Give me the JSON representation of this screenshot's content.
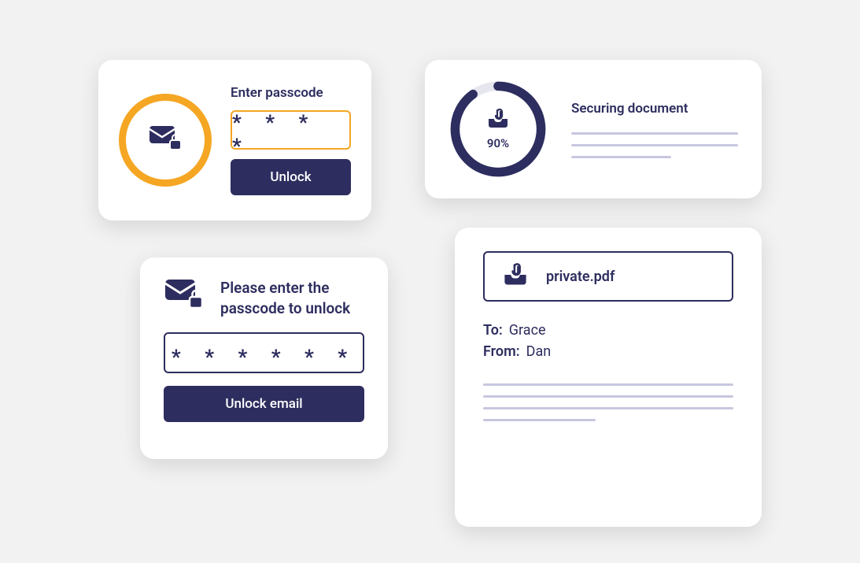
{
  "colors": {
    "navy": "#2d2d5f",
    "orange": "#f5a623",
    "line": "#c7c7df"
  },
  "card1": {
    "title": "Enter passcode",
    "masked": "* * * *",
    "button": "Unlock",
    "icon": "envelope-lock-icon"
  },
  "card2": {
    "title": "Please enter the passcode to unlock",
    "masked": "* * * * * *",
    "button": "Unlock email",
    "icon": "envelope-lock-icon"
  },
  "card3": {
    "title": "Securing document",
    "progress_percent": 90,
    "progress_label": "90%",
    "icon": "inbox-attachment-icon"
  },
  "card4": {
    "filename": "private.pdf",
    "to_label": "To:",
    "to_value": "Grace",
    "from_label": "From:",
    "from_value": "Dan",
    "icon": "inbox-attachment-icon"
  }
}
